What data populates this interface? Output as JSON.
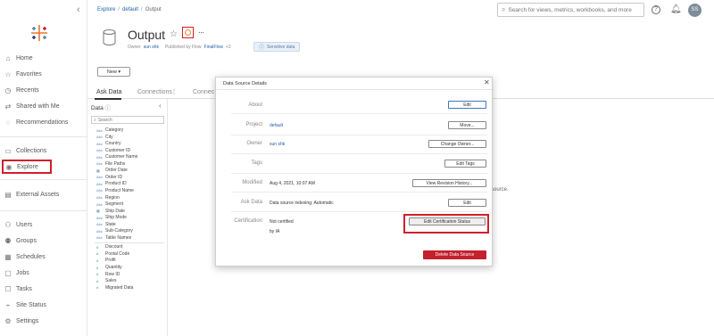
{
  "sidebar": {
    "items": [
      {
        "label": "Home",
        "icon": "home-icon",
        "glyph": "⌂"
      },
      {
        "label": "Favorites",
        "icon": "star-icon",
        "glyph": "☆"
      },
      {
        "label": "Recents",
        "icon": "clock-icon",
        "glyph": "◷"
      },
      {
        "label": "Shared with Me",
        "icon": "share-icon",
        "glyph": "⇄"
      },
      {
        "label": "Recommendations",
        "icon": "bulb-icon",
        "glyph": "◌"
      },
      {
        "label": "Collections",
        "icon": "collection-icon",
        "glyph": "▭"
      },
      {
        "label": "Explore",
        "icon": "compass-icon",
        "glyph": "◉"
      },
      {
        "label": "External Assets",
        "icon": "external-icon",
        "glyph": "▤"
      },
      {
        "label": "Users",
        "icon": "users-icon",
        "glyph": "⚇"
      },
      {
        "label": "Groups",
        "icon": "groups-icon",
        "glyph": "⚉"
      },
      {
        "label": "Schedules",
        "icon": "calendar-icon",
        "glyph": "▦"
      },
      {
        "label": "Jobs",
        "icon": "jobs-icon",
        "glyph": "▢"
      },
      {
        "label": "Tasks",
        "icon": "tasks-icon",
        "glyph": "☐"
      },
      {
        "label": "Site Status",
        "icon": "status-icon",
        "glyph": "⌁"
      },
      {
        "label": "Settings",
        "icon": "gear-icon",
        "glyph": "⚙"
      }
    ]
  },
  "breadcrumb": {
    "root": "Explore",
    "project": "default",
    "current": "Output"
  },
  "search": {
    "placeholder": "Search for views, metrics, workbooks, and more"
  },
  "user": {
    "initials": "SS"
  },
  "header": {
    "title": "Output",
    "owner_label": "Owner",
    "owner": "sun shk",
    "published_label": "Published by Flow",
    "flow": "FinalFlow",
    "extra": "+2",
    "sensitive": "Sensitive data"
  },
  "new_button": "New ▾",
  "tabs": [
    {
      "label": "Ask Data"
    },
    {
      "label": "Connections"
    },
    {
      "label": "Connec"
    }
  ],
  "data_panel": {
    "title": "Data",
    "search_placeholder": "Search",
    "dimensions": [
      {
        "type": "Abc",
        "name": "Category"
      },
      {
        "type": "Abc",
        "name": "City"
      },
      {
        "type": "Abc",
        "name": "Country"
      },
      {
        "type": "Abc",
        "name": "Customer ID"
      },
      {
        "type": "Abc",
        "name": "Customer Name"
      },
      {
        "type": "Abc",
        "name": "File Paths"
      },
      {
        "type": "▦",
        "name": "Order Date"
      },
      {
        "type": "Abc",
        "name": "Order ID"
      },
      {
        "type": "Abc",
        "name": "Product ID"
      },
      {
        "type": "Abc",
        "name": "Product Name"
      },
      {
        "type": "Abc",
        "name": "Region"
      },
      {
        "type": "Abc",
        "name": "Segment"
      },
      {
        "type": "▦",
        "name": "Ship Date"
      },
      {
        "type": "Abc",
        "name": "Ship Mode"
      },
      {
        "type": "Abc",
        "name": "State"
      },
      {
        "type": "Abc",
        "name": "Sub-Category"
      },
      {
        "type": "Abc",
        "name": "Table Names"
      }
    ],
    "measures": [
      {
        "type": "#",
        "name": "Discount"
      },
      {
        "type": "#",
        "name": "Postal Code"
      },
      {
        "type": "#",
        "name": "Profit"
      },
      {
        "type": "#",
        "name": "Quantity"
      },
      {
        "type": "#",
        "name": "Row ID"
      },
      {
        "type": "#",
        "name": "Sales"
      },
      {
        "type": "#",
        "name": "Migrated Data"
      }
    ]
  },
  "background_text": "source.",
  "modal": {
    "title": "Data Source Details",
    "rows": {
      "about": {
        "label": "About",
        "value": "",
        "button": "Edit"
      },
      "project": {
        "label": "Project",
        "value": "default",
        "button": "Move..."
      },
      "owner": {
        "label": "Owner",
        "value": "sun shk",
        "button": "Change Owner..."
      },
      "tags": {
        "label": "Tags",
        "value": "",
        "button": "Edit Tags"
      },
      "modified": {
        "label": "Modified",
        "value": "Aug 4, 2021, 10:07 AM",
        "button": "View Revision History..."
      },
      "askdata": {
        "label": "Ask Data",
        "value": "Data source indexing: Automatic",
        "button": "Edit"
      },
      "certification": {
        "label": "Certification",
        "value": "Not certified",
        "value2": "by IA",
        "button": "Edit Certification Status"
      }
    },
    "delete_button": "Delete Data Source"
  }
}
